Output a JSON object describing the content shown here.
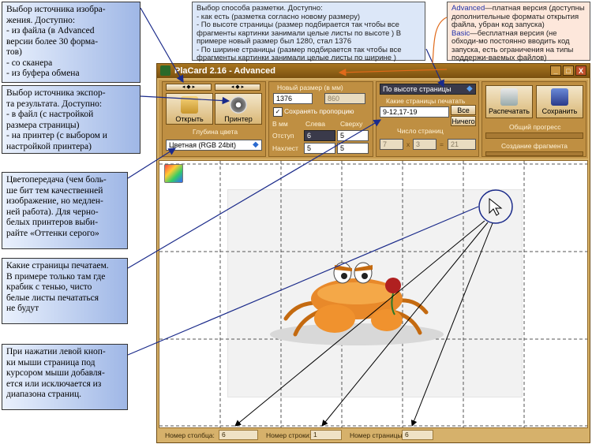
{
  "callouts": {
    "source": "Выбор источника изобра-\nжения. Доступно:\n- из файла (в Advanced\nверсии более 30 форма-\nтов)\n- со сканера\n- из буфера обмена",
    "export": "Выбор источника экспор-\nта результата. Доступно:\n- в файл (с настройкой\nразмера страницы)\n- на принтер (с выбором и\nнастройкой принтера)",
    "color": "Цветопередача (чем боль-\nше бит тем качественней\nизображение, но медлен-\nней работа). Для черно-\nбелых принтеров выби-\nрайте «Оттенки серого»",
    "pages": "Какие страницы печатаем.\nВ примере только там где\nкрабик с тенью, чисто\nбелые листы печататься\nне будут",
    "click": "При нажатии левой кноп-\nки мыши страница под\nкурсором мыши добавля-\nется или исключается из\nдиапазона страниц."
  },
  "note_layout": "Выбор способа разметки. Доступно:\n- как есть (разметка согласно новому размеру)\n- По высоте страницы (размер подбирается так чтобы все\nфрагменты картинки занимали целые листы по высоте ) В\nпримере новый размер был 1280, стал 1376\n- По ширине страницы (размер подбирается так чтобы все\nфрагменты картинки занимали целые листы по ширине )",
  "note_versions": {
    "advanced_word": "Advanced",
    "advanced_text": "—платная версия (доступны дополнительные форматы открытия файла, убран код запуска)",
    "basic_word": "Basic",
    "basic_text": "—бесплатная версия  (не обходи-мо постоянно вводить код запуска, есть ограничения на  типы поддержи-ваемых файлов)"
  },
  "window": {
    "title": "PlaCard 2.16 - Advanced",
    "min": "_",
    "max": "□",
    "close": "X"
  },
  "toolbar": {
    "open_label": "Открыть",
    "printer_label": "Принтер",
    "color_depth_label": "Глубина цвета",
    "color_depth_value": "Цветная (RGB 24bit)",
    "new_size_label": "Новый размер (в мм)",
    "width_value": "1376",
    "height_value": "860",
    "keep_ratio_label": "Сохранять пропорцию",
    "grid_headers": [
      "В мм",
      "Слева",
      "Сверху"
    ],
    "indent_label": "Отступ",
    "indent_left": "6",
    "indent_top": "5",
    "overlap_label": "Нахлест",
    "overlap_left": "5",
    "overlap_top": "5",
    "layout_mode": "По высоте страницы",
    "pages_to_print_label": "Какие страницы печатать",
    "pages_value": "9-12,17-19",
    "all_button": "Все",
    "none_button": "Ничего",
    "page_count_label": "Число страниц",
    "cols": "7",
    "mult": "x",
    "rows": "3",
    "eq": "=",
    "total": "21",
    "print_label": "Распечатать",
    "save_label": "Сохранить",
    "overall_progress": "Общий прогресс",
    "fragment_creation": "Создание фрагмента"
  },
  "status": {
    "col_label": "Номер столбца:",
    "col_value": "6",
    "row_label": "Номер строки:",
    "row_value": "1",
    "page_label": "Номер страницы:",
    "page_value": "6"
  },
  "colors": {
    "accent": "#d9b36a",
    "title": "#8a5c14",
    "arrow": "#1a2a8a",
    "annotation_orange": "#e06a1a"
  }
}
